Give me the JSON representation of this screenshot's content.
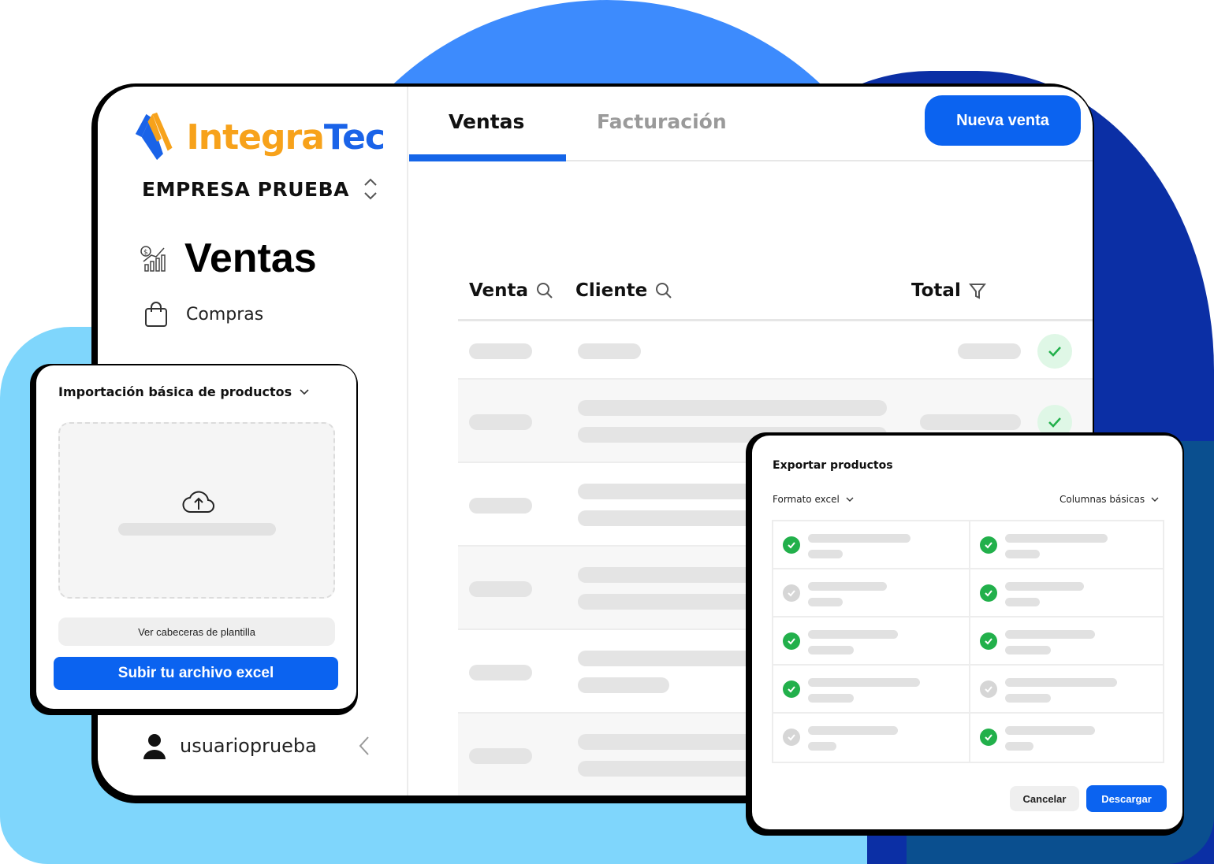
{
  "brand": {
    "name_part1": "Integra",
    "name_part2": "Tec",
    "color_orange": "#f7a21b",
    "color_blue": "#1a63e8"
  },
  "sidebar": {
    "company": "EMPRESA PRUEBA",
    "items": [
      {
        "label": "Ventas",
        "icon": "sales-chart-icon",
        "active": true
      },
      {
        "label": "Compras",
        "icon": "shopping-bag-icon",
        "active": false
      }
    ],
    "user": "usuarioprueba"
  },
  "tabs": [
    {
      "label": "Ventas",
      "active": true
    },
    {
      "label": "Facturación",
      "active": false
    }
  ],
  "header": {
    "new_sale_label": "Nueva venta"
  },
  "table": {
    "columns": [
      "Venta",
      "Cliente",
      "Total"
    ]
  },
  "import_card": {
    "title": "Importación básica de productos",
    "view_headers_label": "Ver cabeceras de plantilla",
    "upload_label": "Subir tu archivo excel"
  },
  "export_card": {
    "title": "Exportar productos",
    "format_label": "Formato excel",
    "columns_label": "Columnas básicas",
    "cancel_label": "Cancelar",
    "download_label": "Descargar",
    "checks": [
      [
        true,
        true
      ],
      [
        false,
        true
      ],
      [
        true,
        true
      ],
      [
        true,
        false
      ],
      [
        false,
        true
      ]
    ]
  },
  "colors": {
    "accent": "#0b63f0",
    "success": "#22b04b"
  }
}
